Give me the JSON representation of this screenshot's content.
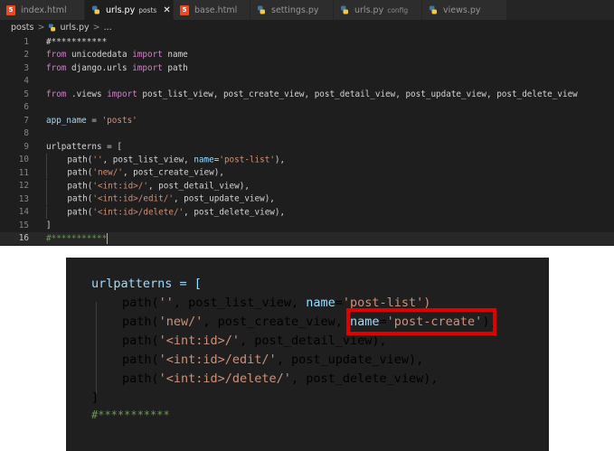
{
  "tabs": [
    {
      "label": "index.html",
      "icon": "html5-icon",
      "sublabel": "",
      "active": false
    },
    {
      "label": "urls.py",
      "icon": "python-icon",
      "sublabel": "posts",
      "active": true
    },
    {
      "label": "base.html",
      "icon": "html5-icon",
      "sublabel": "",
      "active": false
    },
    {
      "label": "settings.py",
      "icon": "python-icon",
      "sublabel": "",
      "active": false
    },
    {
      "label": "urls.py",
      "icon": "python-icon",
      "sublabel": "config",
      "active": false
    },
    {
      "label": "views.py",
      "icon": "python-icon",
      "sublabel": "",
      "active": false
    }
  ],
  "close_glyph": "✕",
  "breadcrumb": {
    "folder": "posts",
    "sep": ">",
    "file": "urls.py",
    "sep2": ">",
    "tail": "..."
  },
  "line_numbers": [
    "1",
    "2",
    "3",
    "4",
    "5",
    "6",
    "7",
    "8",
    "9",
    "10",
    "11",
    "12",
    "13",
    "14",
    "15",
    "16"
  ],
  "code": {
    "l1": "#***********",
    "from": "from",
    "import": "import",
    "l2_mod": "unicodedata",
    "l2_name": "name",
    "l3_mod": "django.urls",
    "l3_name": "path",
    "l5_mod": ".views",
    "l5_names": "post_list_view, post_create_view, post_detail_view, post_update_view, post_delete_view",
    "l7_var": "app_name",
    "l7_eq": " = ",
    "l7_val": "'posts'",
    "l9": "urlpatterns = [",
    "path_open": "path(",
    "l10_str": "''",
    "l10_mid": ", post_list_view, ",
    "name_kw": "name",
    "eq": "=",
    "l10_nm": "'post-list'",
    "l10_end": "),",
    "l11_str": "'new/'",
    "l11_rest": ", post_create_view),",
    "l12_str": "'<int:id>/'",
    "l12_rest": ", post_detail_view),",
    "l13_str": "'<int:id>/edit/'",
    "l13_rest": ", post_update_view),",
    "l14_str": "'<int:id>/delete/'",
    "l14_rest": ", post_delete_view),",
    "l15": "]",
    "l16": "#***********"
  },
  "zoom": {
    "l11_str_nm": "'post-create'",
    "l11_rest_a": ", post_create_view, ",
    "l11_end": "),",
    "l10_nm_partial": "'post-list')"
  },
  "colors": {
    "keyword": "#c586c0",
    "string": "#ce9178",
    "comment": "#6a9955",
    "param": "#9cdcfe",
    "highlight": "#e00000"
  }
}
